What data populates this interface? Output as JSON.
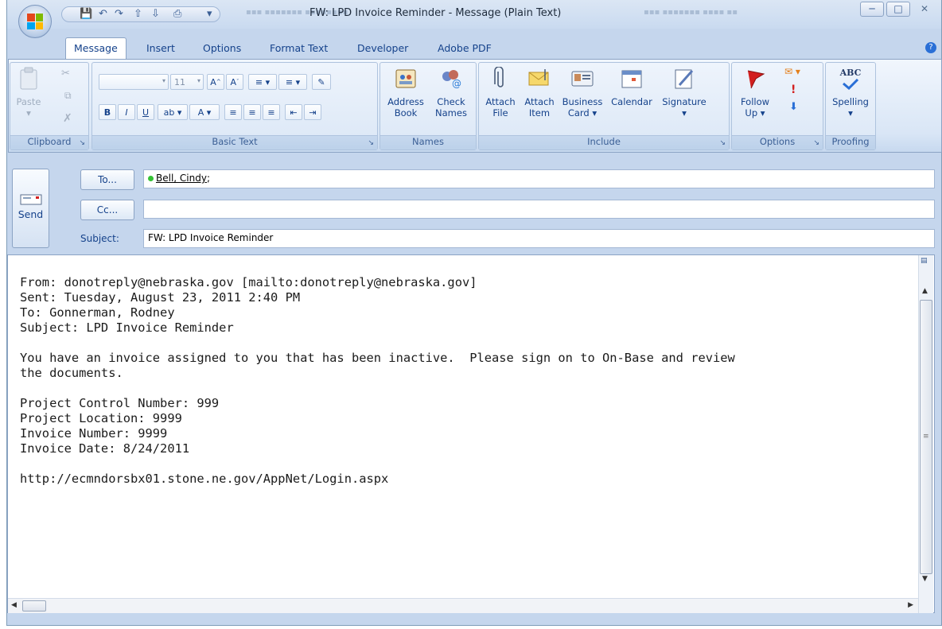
{
  "window": {
    "title": "FW: LPD Invoice Reminder - Message (Plain Text)",
    "minimize_icon": "minimize-icon",
    "maximize_icon": "maximize-icon",
    "close_icon": "close-icon"
  },
  "tabs": [
    "Message",
    "Insert",
    "Options",
    "Format Text",
    "Developer",
    "Adobe PDF"
  ],
  "active_tab": "Message",
  "ribbon": {
    "clipboard": {
      "label": "Clipboard",
      "paste": "Paste"
    },
    "basic_text": {
      "label": "Basic Text",
      "font_size": "11"
    },
    "names": {
      "label": "Names",
      "address_book": [
        "Address",
        "Book"
      ],
      "check_names": [
        "Check",
        "Names"
      ]
    },
    "include": {
      "label": "Include",
      "attach_file": [
        "Attach",
        "File"
      ],
      "attach_item": [
        "Attach",
        "Item"
      ],
      "business_card": [
        "Business",
        "Card ▾"
      ],
      "calendar": "Calendar",
      "signature": "Signature"
    },
    "options": {
      "label": "Options",
      "follow_up": [
        "Follow",
        "Up ▾"
      ]
    },
    "proofing": {
      "label": "Proofing",
      "spelling": "Spelling",
      "abc": "ABC"
    }
  },
  "header": {
    "send_label": "Send",
    "to_button": "To...",
    "cc_button": "Cc...",
    "subject_label": "Subject:",
    "to_value": "Bell, Cindy",
    "to_separator": ";",
    "cc_value": "",
    "subject_value": "FW: LPD Invoice Reminder"
  },
  "body_lines": [
    "From: donotreply@nebraska.gov [mailto:donotreply@nebraska.gov]",
    "Sent: Tuesday, August 23, 2011 2:40 PM",
    "To: Gonnerman, Rodney",
    "Subject: LPD Invoice Reminder",
    "",
    "You have an invoice assigned to you that has been inactive.  Please sign on to On-Base and review",
    "the documents.",
    "",
    "Project Control Number: 999",
    "Project Location: 9999",
    "Invoice Number: 9999",
    "Invoice Date: 8/24/2011",
    "",
    "http://ecmndorsbx01.stone.ne.gov/AppNet/Login.aspx"
  ],
  "colors": {
    "ribbon_text": "#15428b",
    "presence_green": "#34c234",
    "flag_red": "#d21f1f"
  }
}
